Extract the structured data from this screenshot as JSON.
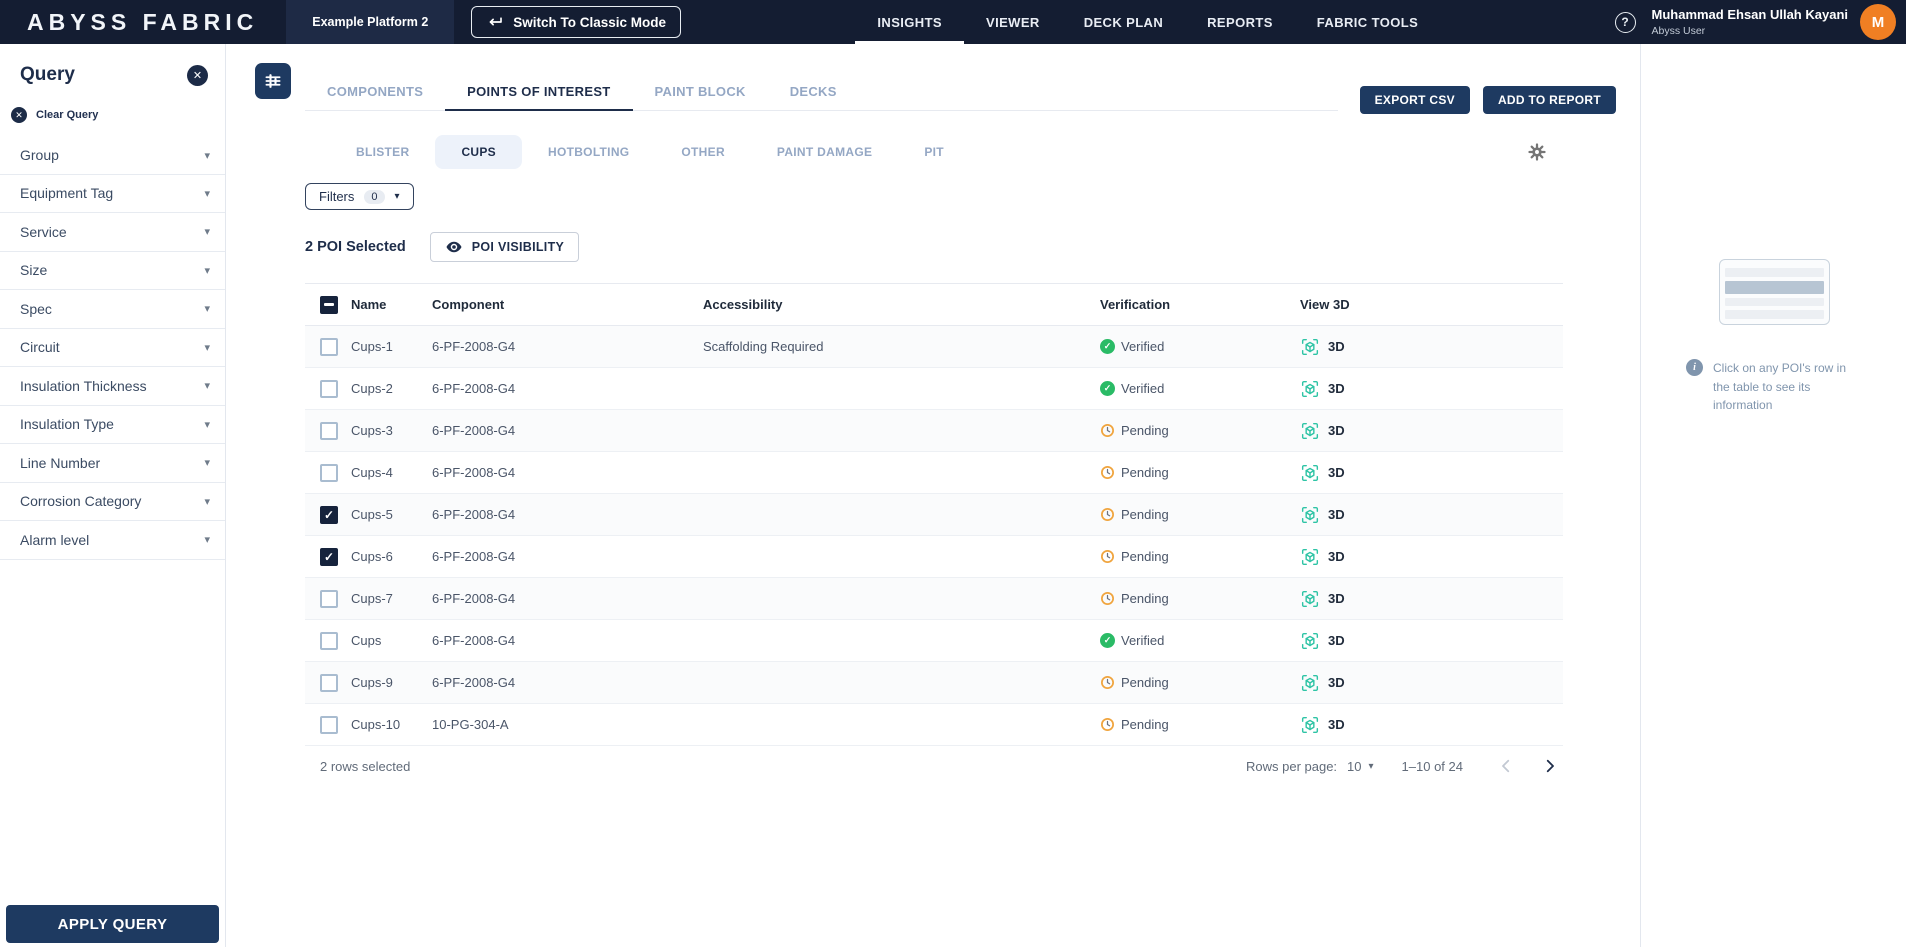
{
  "colors": {
    "topbar_bg": "#141d32",
    "platform_bg": "#1e2a45",
    "primary_navy": "#1e3a61",
    "dark_text": "#1e2d4a",
    "muted_blue": "#94a7c4",
    "verified_green": "#2abb66",
    "pending_orange": "#f0a53f",
    "teal_3d": "#2ec4a5",
    "avatar_orange": "#f07f23"
  },
  "topbar": {
    "logo": "ABYSS FABRIC",
    "platform": "Example Platform 2",
    "classic_mode_label": "Switch To Classic Mode",
    "nav": [
      {
        "label": "INSIGHTS",
        "active": true
      },
      {
        "label": "VIEWER",
        "active": false
      },
      {
        "label": "DECK PLAN",
        "active": false
      },
      {
        "label": "REPORTS",
        "active": false
      },
      {
        "label": "FABRIC TOOLS",
        "active": false
      }
    ],
    "help_icon": "?",
    "user": {
      "name": "Muhammad Ehsan Ullah Kayani",
      "role": "Abyss User",
      "avatar_initial": "M"
    }
  },
  "sidebar": {
    "title": "Query",
    "clear_label": "Clear Query",
    "filters": [
      "Group",
      "Equipment Tag",
      "Service",
      "Size",
      "Spec",
      "Circuit",
      "Insulation Thickness",
      "Insulation Type",
      "Line Number",
      "Corrosion Category",
      "Alarm level"
    ],
    "apply_label": "APPLY QUERY"
  },
  "main": {
    "tabs": [
      {
        "label": "COMPONENTS",
        "active": false
      },
      {
        "label": "POINTS OF INTEREST",
        "active": true
      },
      {
        "label": "PAINT BLOCK",
        "active": false
      },
      {
        "label": "DECKS",
        "active": false
      }
    ],
    "actions": {
      "export_csv": "EXPORT CSV",
      "add_to_report": "ADD TO REPORT"
    },
    "subtabs": [
      {
        "label": "BLISTER",
        "active": false
      },
      {
        "label": "CUPS",
        "active": true
      },
      {
        "label": "HOTBOLTING",
        "active": false
      },
      {
        "label": "OTHER",
        "active": false
      },
      {
        "label": "PAINT DAMAGE",
        "active": false
      },
      {
        "label": "PIT",
        "active": false
      }
    ],
    "filters_button": {
      "label": "Filters",
      "count": "0"
    },
    "selection_text": "2 POI Selected",
    "poi_visibility_label": "POI VISIBILITY",
    "table": {
      "columns": [
        "Name",
        "Component",
        "Accessibility",
        "Verification",
        "View 3D"
      ],
      "view3d_label": "3D",
      "rows": [
        {
          "name": "Cups-1",
          "component": "6-PF-2008-G4",
          "accessibility": "Scaffolding Required",
          "verification": "Verified",
          "checked": false
        },
        {
          "name": "Cups-2",
          "component": "6-PF-2008-G4",
          "accessibility": "",
          "verification": "Verified",
          "checked": false
        },
        {
          "name": "Cups-3",
          "component": "6-PF-2008-G4",
          "accessibility": "",
          "verification": "Pending",
          "checked": false
        },
        {
          "name": "Cups-4",
          "component": "6-PF-2008-G4",
          "accessibility": "",
          "verification": "Pending",
          "checked": false
        },
        {
          "name": "Cups-5",
          "component": "6-PF-2008-G4",
          "accessibility": "",
          "verification": "Pending",
          "checked": true
        },
        {
          "name": "Cups-6",
          "component": "6-PF-2008-G4",
          "accessibility": "",
          "verification": "Pending",
          "checked": true
        },
        {
          "name": "Cups-7",
          "component": "6-PF-2008-G4",
          "accessibility": "",
          "verification": "Pending",
          "checked": false
        },
        {
          "name": "Cups",
          "component": "6-PF-2008-G4",
          "accessibility": "",
          "verification": "Verified",
          "checked": false
        },
        {
          "name": "Cups-9",
          "component": "6-PF-2008-G4",
          "accessibility": "",
          "verification": "Pending",
          "checked": false
        },
        {
          "name": "Cups-10",
          "component": "10-PG-304-A",
          "accessibility": "",
          "verification": "Pending",
          "checked": false
        }
      ]
    },
    "footer": {
      "rows_selected": "2 rows selected",
      "rows_per_page_label": "Rows per page:",
      "rows_per_page_value": "10",
      "range_text": "1–10 of 24"
    }
  },
  "right_panel": {
    "hint_text": "Click on any POI's row in the table to see its information"
  }
}
